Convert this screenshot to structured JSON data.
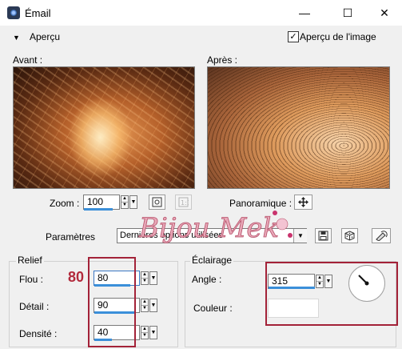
{
  "window": {
    "title": "Émail",
    "minimize": "—",
    "maximize": "☐",
    "close": "✕"
  },
  "header": {
    "preview_toggle": "Aperçu",
    "image_preview_label": "Aperçu de l'image",
    "image_preview_checked": true
  },
  "previews": {
    "before_label": "Avant :",
    "after_label": "Après :"
  },
  "zoom": {
    "label": "Zoom :",
    "value": "100"
  },
  "pan": {
    "label": "Panoramique :"
  },
  "presets": {
    "label": "Paramètres",
    "value": "Dernières options utilisées"
  },
  "watermark": {
    "text": "Bijou Mek"
  },
  "relief": {
    "title": "Relief",
    "flou_label": "Flou :",
    "flou_value": "80",
    "detail_label": "Détail :",
    "detail_value": "90",
    "densite_label": "Densité :",
    "densite_value": "40",
    "annotation": "80",
    "flou_level": 0.8,
    "detail_level": 0.9,
    "densite_level": 0.4
  },
  "lighting": {
    "title": "Éclairage",
    "angle_label": "Angle :",
    "angle_value": "315",
    "color_label": "Couleur :"
  },
  "colors": {
    "accent": "#3b8fd9",
    "annotation_red": "#a32238"
  }
}
